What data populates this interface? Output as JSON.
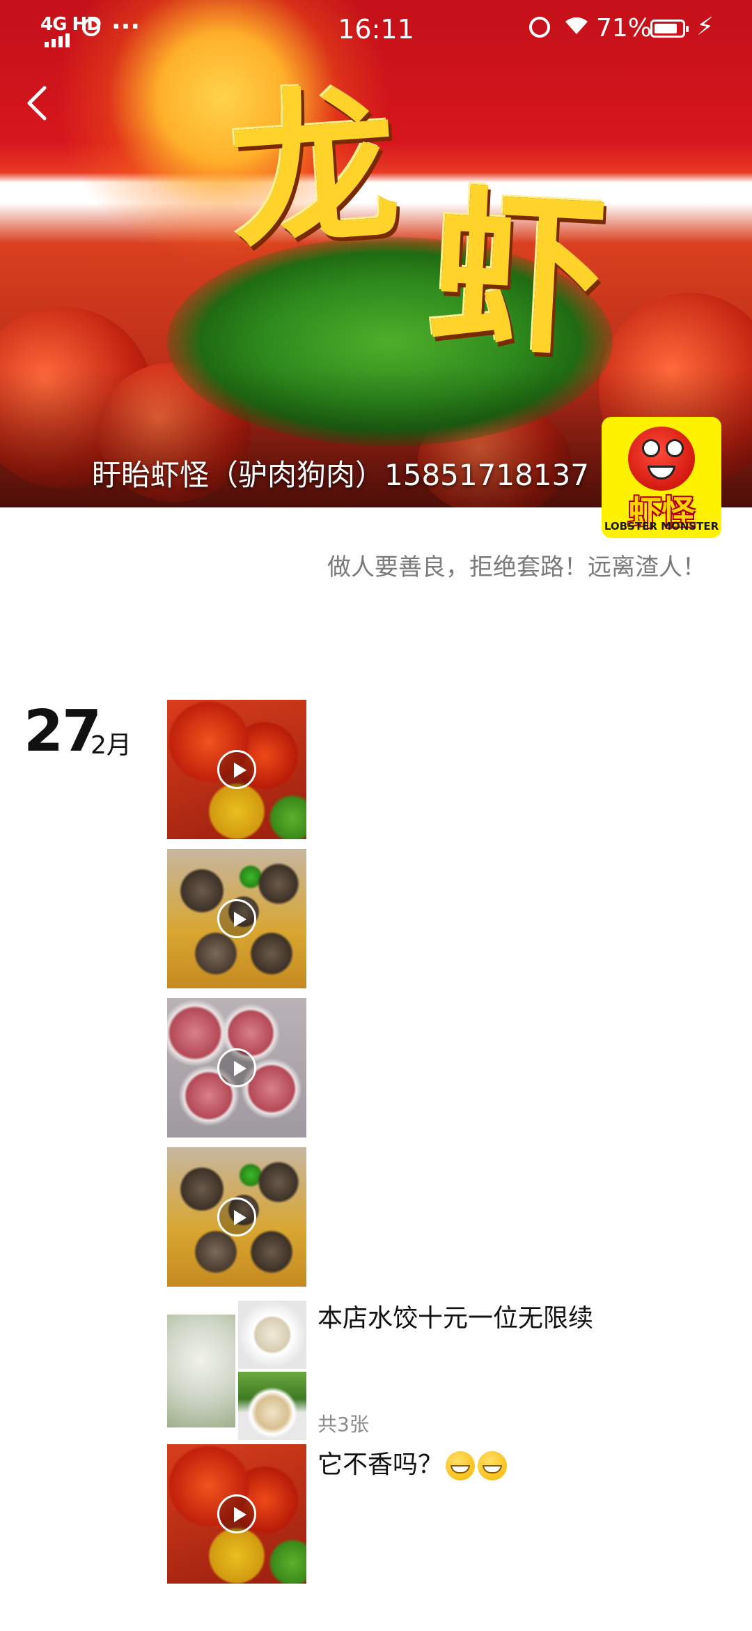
{
  "status_bar": {
    "network": "4G HD",
    "time": "16:11",
    "battery_percent": "71%",
    "more_glyph": "···",
    "wifi_glyph": "wifi-icon",
    "charging_glyph": "⚡"
  },
  "cover": {
    "title": "龙虾",
    "title_char_1": "龙",
    "title_char_2": "虾",
    "name": "盱眙虾怪（驴肉狗肉）15851718137"
  },
  "avatar": {
    "brand": "虾怪",
    "sub": "LOBSTER MONSTER"
  },
  "signature": "做人要善良，拒绝套路！远离渣人！",
  "date": {
    "day": "27",
    "month": "2月"
  },
  "posts": [
    {
      "type": "video",
      "thumb": "lobster"
    },
    {
      "type": "video",
      "thumb": "snail"
    },
    {
      "type": "video",
      "thumb": "meat"
    },
    {
      "type": "video",
      "thumb": "snail"
    },
    {
      "type": "images",
      "text": "本店水饺十元一位无限续",
      "count": "共3张"
    },
    {
      "type": "video",
      "thumb": "lobster",
      "text": "它不香吗？"
    }
  ],
  "colors": {
    "cover_red": "#c4101a",
    "avatar_yellow": "#fff200",
    "signature_gray": "#7a7a7a"
  }
}
